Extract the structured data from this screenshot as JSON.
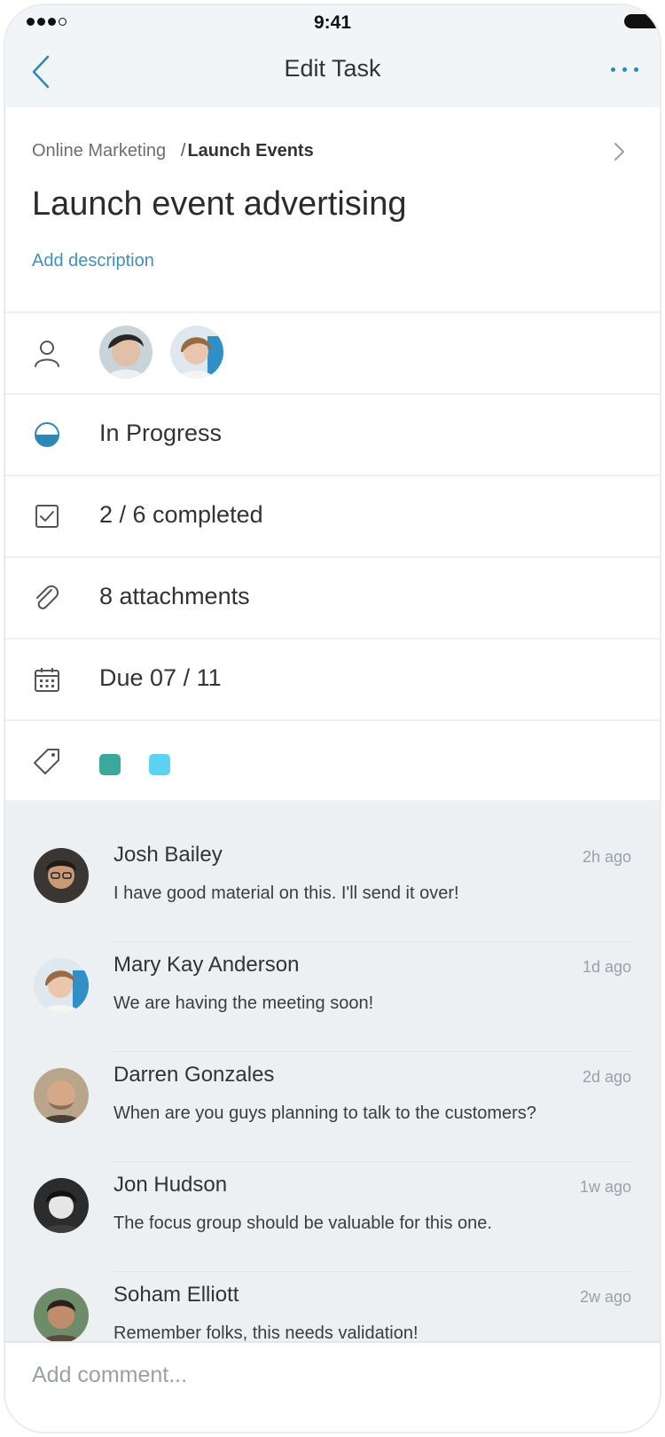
{
  "status_bar": {
    "time": "9:41"
  },
  "nav": {
    "title": "Edit Task",
    "back_icon": "chevron-left-icon",
    "more_icon": "more-horizontal-icon"
  },
  "breadcrumb": {
    "project": "Online Marketing",
    "separator": "/",
    "current": "Launch Events"
  },
  "task": {
    "title": "Launch event advertising",
    "add_description": "Add description"
  },
  "properties": {
    "assignees_icon": "person-icon",
    "status": {
      "icon": "half-circle-icon",
      "label": "In Progress"
    },
    "checklist": {
      "icon": "checkbox-icon",
      "label": "2 / 6 completed"
    },
    "attachments": {
      "icon": "paperclip-icon",
      "label": "8 attachments"
    },
    "due": {
      "icon": "calendar-icon",
      "label": "Due 07 / 11"
    },
    "tags": {
      "icon": "tag-icon",
      "colors": [
        "#3aa89a",
        "#5cd3f2"
      ]
    }
  },
  "comments": [
    {
      "name": "Josh Bailey",
      "time": "2h ago",
      "text": "I have good material on this. I'll send it over!"
    },
    {
      "name": "Mary Kay Anderson",
      "time": "1d ago",
      "text": "We are having the meeting soon!"
    },
    {
      "name": "Darren Gonzales",
      "time": "2d ago",
      "text": "When are you guys planning to talk to the customers?"
    },
    {
      "name": "Jon Hudson",
      "time": "1w ago",
      "text": "The focus group should be valuable for this one."
    },
    {
      "name": "Soham Elliott",
      "time": "2w ago",
      "text": "Remember folks, this needs validation!"
    }
  ],
  "composer": {
    "placeholder": "Add comment..."
  },
  "colors": {
    "accent": "#2f87b5",
    "status_fill": "#2f87b5"
  }
}
